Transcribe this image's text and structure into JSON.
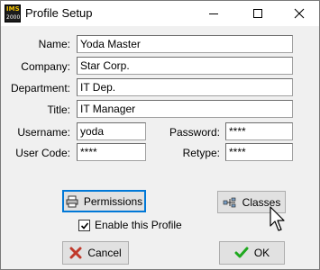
{
  "window": {
    "title": "Profile Setup",
    "app_icon_top": "IMS",
    "app_icon_bottom": "2000"
  },
  "form": {
    "name_label": "Name:",
    "name_value": "Yoda Master",
    "company_label": "Company:",
    "company_value": "Star Corp.",
    "department_label": "Department:",
    "department_value": "IT Dep.",
    "title_label": "Title:",
    "title_value": "IT Manager",
    "username_label": "Username:",
    "username_value": "yoda",
    "password_label": "Password:",
    "password_value": "****",
    "usercode_label": "User Code:",
    "usercode_value": "****",
    "retype_label": "Retype:",
    "retype_value": "****"
  },
  "buttons": {
    "permissions": "Permissions",
    "classes": "Classes",
    "cancel": "Cancel",
    "ok": "OK"
  },
  "checkbox": {
    "label": "Enable this Profile",
    "checked": true
  },
  "icons": {
    "app": "ims-app-icon",
    "permissions": "printer-icon",
    "classes": "network-classes-icon",
    "cancel": "red-x-icon",
    "ok": "green-check-icon",
    "cursor": "mouse-pointer-icon"
  },
  "colors": {
    "window_bg": "#f0f0f0",
    "focus_border": "#0078d7",
    "cancel_x": "#c0392b",
    "ok_check": "#1ea81e"
  }
}
